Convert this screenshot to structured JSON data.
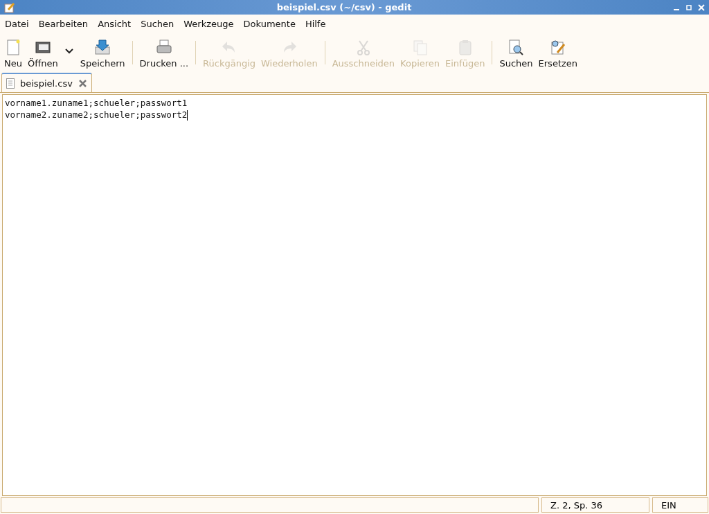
{
  "window": {
    "title": "beispiel.csv (~/csv) - gedit"
  },
  "menu": [
    "Datei",
    "Bearbeiten",
    "Ansicht",
    "Suchen",
    "Werkzeuge",
    "Dokumente",
    "Hilfe"
  ],
  "toolbar": [
    {
      "kind": "button",
      "label": "Neu",
      "disabled": false
    },
    {
      "kind": "button",
      "label": "Öffnen",
      "disabled": false
    },
    {
      "kind": "dropdown"
    },
    {
      "kind": "button",
      "label": "Speichern",
      "disabled": false
    },
    {
      "kind": "separator"
    },
    {
      "kind": "button",
      "label": "Drucken ...",
      "disabled": false
    },
    {
      "kind": "separator"
    },
    {
      "kind": "button",
      "label": "Rückgängig",
      "disabled": true
    },
    {
      "kind": "button",
      "label": "Wiederholen",
      "disabled": true
    },
    {
      "kind": "separator"
    },
    {
      "kind": "button",
      "label": "Ausschneiden",
      "disabled": true
    },
    {
      "kind": "button",
      "label": "Kopieren",
      "disabled": true
    },
    {
      "kind": "button",
      "label": "Einfügen",
      "disabled": true
    },
    {
      "kind": "separator"
    },
    {
      "kind": "button",
      "label": "Suchen",
      "disabled": false
    },
    {
      "kind": "button",
      "label": "Ersetzen",
      "disabled": false
    }
  ],
  "tabs": [
    {
      "label": "beispiel.csv",
      "selected": true
    }
  ],
  "editor": {
    "lines": [
      "vorname1.zuname1;schueler;passwort1",
      "vorname2.zuname2;schueler;passwort2"
    ]
  },
  "status_bar": {
    "position": "Z. 2, Sp. 36",
    "mode": "EIN"
  }
}
